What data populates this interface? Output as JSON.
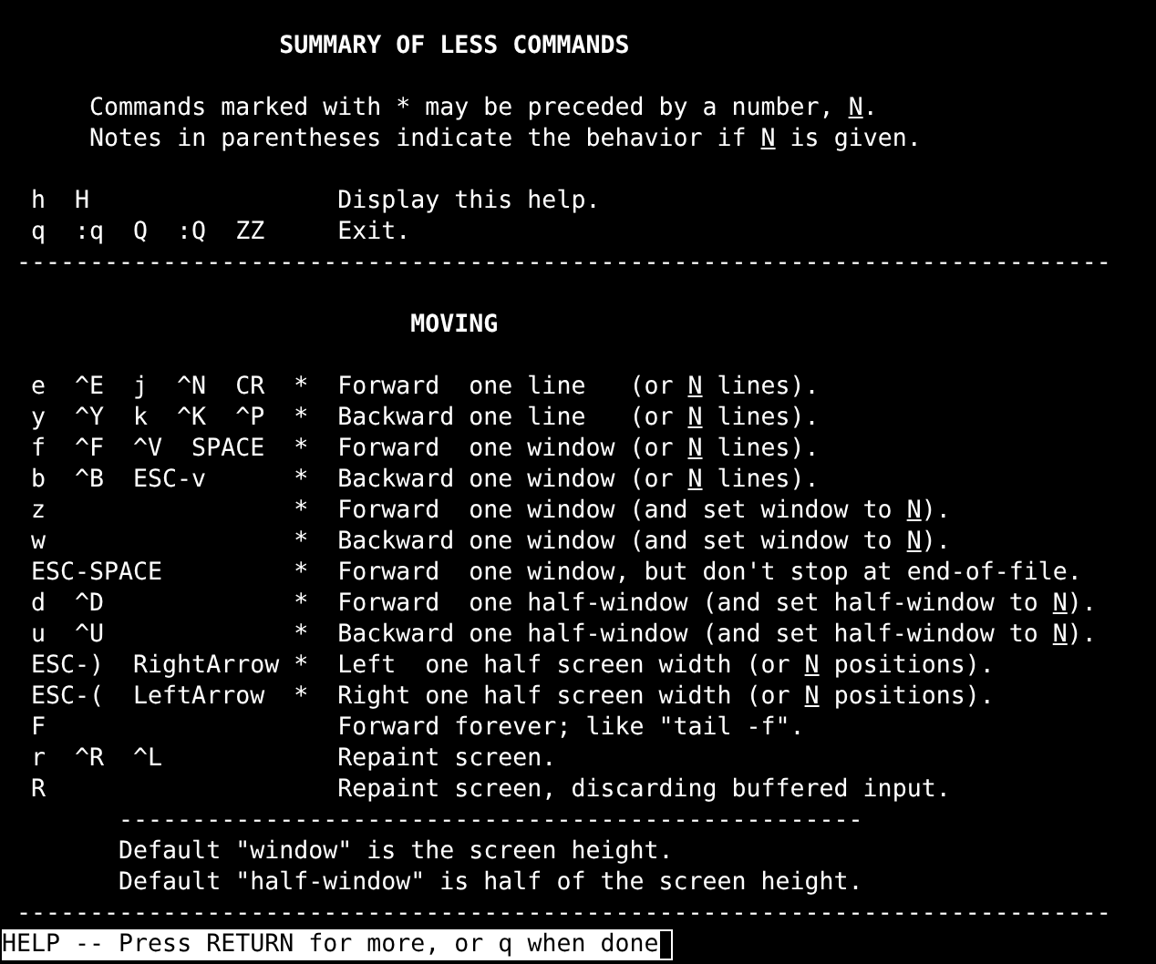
{
  "lines": [
    {
      "kind": "title",
      "text": "SUMMARY OF LESS COMMANDS"
    },
    {
      "kind": "gap"
    },
    {
      "kind": "intro",
      "text": [
        {
          "text": "Commands marked with * may be preceded by a number, ",
          "underline": false
        },
        {
          "text": "N",
          "underline": true
        },
        {
          "text": ".",
          "underline": false
        }
      ]
    },
    {
      "kind": "intro",
      "text": [
        {
          "text": "Notes in parentheses indicate the behavior if ",
          "underline": false
        },
        {
          "text": "N",
          "underline": true
        },
        {
          "text": " is given.",
          "underline": false
        }
      ]
    },
    {
      "kind": "gap"
    },
    {
      "kind": "command",
      "keys": "h  H",
      "description": "Display this help."
    },
    {
      "kind": "command",
      "keys": "q  :q  Q  :Q  ZZ",
      "description": "Exit."
    },
    {
      "kind": "rule",
      "text": "---------------------------------------------------------------------------"
    },
    {
      "kind": "gap"
    },
    {
      "kind": "title",
      "text": "MOVING"
    },
    {
      "kind": "gap"
    },
    {
      "kind": "command",
      "keys": "e  ^E  j  ^N  CR",
      "marker": "*",
      "description": [
        {
          "text": "Forward  one line   (or ",
          "underline": false
        },
        {
          "text": "N",
          "underline": true
        },
        {
          "text": " lines).",
          "underline": false
        }
      ]
    },
    {
      "kind": "command",
      "keys": "y  ^Y  k  ^K  ^P",
      "marker": "*",
      "description": [
        {
          "text": "Backward one line   (or ",
          "underline": false
        },
        {
          "text": "N",
          "underline": true
        },
        {
          "text": " lines).",
          "underline": false
        }
      ]
    },
    {
      "kind": "command",
      "keys": "f  ^F  ^V  SPACE",
      "marker": "*",
      "description": [
        {
          "text": "Forward  one window (or ",
          "underline": false
        },
        {
          "text": "N",
          "underline": true
        },
        {
          "text": " lines).",
          "underline": false
        }
      ]
    },
    {
      "kind": "command",
      "keys": "b  ^B  ESC-v",
      "marker": "*",
      "description": [
        {
          "text": "Backward one window (or ",
          "underline": false
        },
        {
          "text": "N",
          "underline": true
        },
        {
          "text": " lines).",
          "underline": false
        }
      ]
    },
    {
      "kind": "command",
      "keys": "z",
      "marker": "*",
      "description": [
        {
          "text": "Forward  one window (and set window to ",
          "underline": false
        },
        {
          "text": "N",
          "underline": true
        },
        {
          "text": ").",
          "underline": false
        }
      ]
    },
    {
      "kind": "command",
      "keys": "w",
      "marker": "*",
      "description": [
        {
          "text": "Backward one window (and set window to ",
          "underline": false
        },
        {
          "text": "N",
          "underline": true
        },
        {
          "text": ").",
          "underline": false
        }
      ]
    },
    {
      "kind": "command",
      "keys": "ESC-SPACE",
      "marker": "*",
      "description": "Forward  one window, but don't stop at end-of-file."
    },
    {
      "kind": "command",
      "keys": "d  ^D",
      "marker": "*",
      "description": [
        {
          "text": "Forward  one half-window (and set half-window to ",
          "underline": false
        },
        {
          "text": "N",
          "underline": true
        },
        {
          "text": ").",
          "underline": false
        }
      ]
    },
    {
      "kind": "command",
      "keys": "u  ^U",
      "marker": "*",
      "description": [
        {
          "text": "Backward one half-window (and set half-window to ",
          "underline": false
        },
        {
          "text": "N",
          "underline": true
        },
        {
          "text": ").",
          "underline": false
        }
      ]
    },
    {
      "kind": "command",
      "keys": "ESC-)  RightArrow",
      "marker": "*",
      "description": [
        {
          "text": "Left  one half screen width (or ",
          "underline": false
        },
        {
          "text": "N",
          "underline": true
        },
        {
          "text": " positions).",
          "underline": false
        }
      ]
    },
    {
      "kind": "command",
      "keys": "ESC-(  LeftArrow",
      "marker": "*",
      "description": [
        {
          "text": "Right one half screen width (or ",
          "underline": false
        },
        {
          "text": "N",
          "underline": true
        },
        {
          "text": " positions).",
          "underline": false
        }
      ]
    },
    {
      "kind": "command",
      "keys": "F",
      "description": "Forward forever; like \"tail -f\"."
    },
    {
      "kind": "command",
      "keys": "r  ^R  ^L",
      "description": "Repaint screen."
    },
    {
      "kind": "command",
      "keys": "R",
      "description": "Repaint screen, discarding buffered input."
    },
    {
      "kind": "subrule",
      "text": "---------------------------------------------------"
    },
    {
      "kind": "footnote",
      "text": "Default \"window\" is the screen height."
    },
    {
      "kind": "footnote",
      "text": "Default \"half-window\" is half of the screen height."
    },
    {
      "kind": "rule",
      "text": "---------------------------------------------------------------------------"
    }
  ],
  "prompt": "HELP -- Press RETURN for more, or q when done"
}
